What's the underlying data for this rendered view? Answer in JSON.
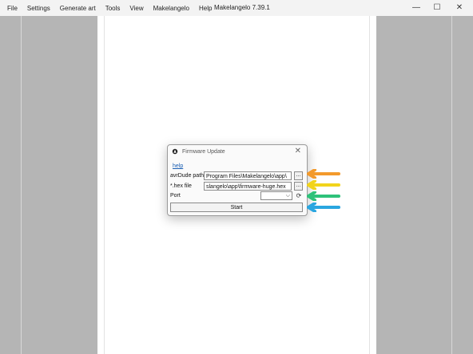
{
  "menubar": {
    "items": [
      "File",
      "Settings",
      "Generate art",
      "Tools",
      "View",
      "Makelangelo",
      "Help"
    ]
  },
  "window": {
    "title": "Makelangelo 7.39.1",
    "minimize": "—",
    "maximize": "☐",
    "close": "✕"
  },
  "dialog": {
    "title": "Firmware Update",
    "close": "✕",
    "help_link": "help",
    "avrdude_label": "avrDude path",
    "avrdude_value": "Program Files\\Makelangelo\\app\\",
    "avrdude_browse": "...",
    "hex_label": "*.hex file",
    "hex_value": "slangelo\\app\\firmware-huge.hex",
    "hex_browse": "...",
    "port_label": "Port",
    "port_value": "",
    "refresh": "⟳",
    "start_label": "Start"
  },
  "annotations": {
    "arrow_colors": [
      "#f39a2c",
      "#f2d41c",
      "#2ec27a",
      "#2aa6e0"
    ]
  }
}
